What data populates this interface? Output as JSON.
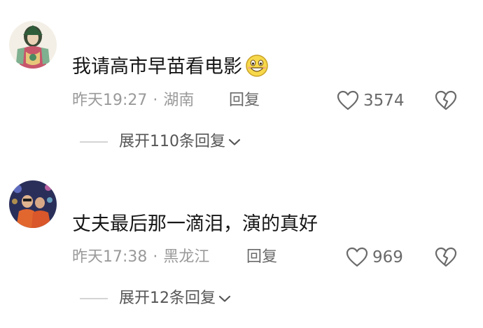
{
  "comments": [
    {
      "username": "",
      "text": "我请高市早苗看电影",
      "emoji": "grinning-face-emoji",
      "time": "昨天19:27",
      "separator": "·",
      "location": "湖南",
      "reply_label": "回复",
      "like_count": "3574",
      "expand_label": "展开110条回复"
    },
    {
      "username": "",
      "text": "丈夫最后那一滴泪，演的真好",
      "time": "昨天17:38",
      "separator": "·",
      "location": "黑龙江",
      "reply_label": "回复",
      "like_count": "969",
      "expand_label": "展开12条回复"
    }
  ],
  "icons": {
    "like": "heart-outline-icon",
    "dislike": "broken-heart-icon",
    "expand": "chevron-down-icon"
  },
  "colors": {
    "text": "#161616",
    "meta": "#9a9a9a",
    "action": "#6a6a6a",
    "expand": "#555555",
    "divider": "#d4d4d4",
    "emoji_face": "#f7d84a"
  }
}
